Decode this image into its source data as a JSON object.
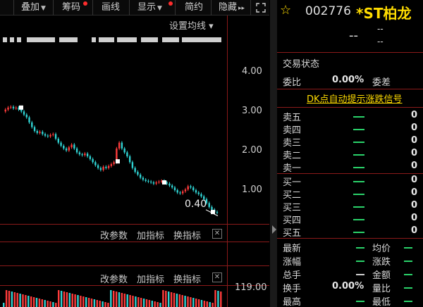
{
  "toolbar": {
    "items": [
      {
        "label": "叠加",
        "arrow": "▼",
        "dot": false
      },
      {
        "label": "筹码",
        "arrow": "",
        "dot": true
      },
      {
        "label": "画线",
        "arrow": "",
        "dot": false
      },
      {
        "label": "显示",
        "arrow": "▼",
        "dot": true
      },
      {
        "label": "简约",
        "arrow": "",
        "dot": false
      },
      {
        "label": "隐藏",
        "arrow": "▸▸",
        "dot": false
      }
    ],
    "expand_icon": "expand-icon"
  },
  "chart": {
    "ma_setting_label": "设置均线",
    "ma_setting_arrow": "▾",
    "y_ticks": [
      "4.00",
      "3.00",
      "2.00",
      "1.00"
    ],
    "last_price_label": "0.40",
    "price_panel_buttons": [
      "改参数",
      "加指标",
      "换指标"
    ],
    "volume_panel_buttons": [
      "改参数",
      "加指标",
      "换指标"
    ],
    "close_symbol": "✕",
    "volume_axis_top": "119.00",
    "up_color": "#ff3b3b",
    "down_color": "#2fd3d3",
    "price_series": [
      3.0,
      3.05,
      3.1,
      3.12,
      3.08,
      3.1,
      3.05,
      3.0,
      2.92,
      2.85,
      2.72,
      2.6,
      2.5,
      2.45,
      2.48,
      2.42,
      2.38,
      2.36,
      2.4,
      2.42,
      2.3,
      2.2,
      2.12,
      2.05,
      2.0,
      2.08,
      2.15,
      2.05,
      1.95,
      1.9,
      1.88,
      1.92,
      1.85,
      1.78,
      1.7,
      1.62,
      1.55,
      1.5,
      1.58,
      1.55,
      1.6,
      1.65,
      1.7,
      2.05,
      2.2,
      2.05,
      1.95,
      1.85,
      1.7,
      1.55,
      1.45,
      1.38,
      1.3,
      1.25,
      1.22,
      1.2,
      1.18,
      1.15,
      1.18,
      1.2,
      1.22,
      1.18,
      1.15,
      1.1,
      1.05,
      0.98,
      0.92,
      0.9,
      0.95,
      1.0,
      1.08,
      1.05,
      0.98,
      0.92,
      0.88,
      0.82,
      0.75,
      0.65,
      0.55,
      0.48,
      0.42,
      0.4
    ]
  },
  "quote": {
    "code": "002776",
    "name": "*ST柏龙",
    "price": "--",
    "change": "--",
    "change_pct": "--",
    "trade_status_label": "交易状态",
    "weibi_label": "委比",
    "weibi_value": "0.00%",
    "weicha_label": "委差",
    "dk_link": "DK点自动提示涨跌信号",
    "sell_labels": [
      "卖五",
      "卖四",
      "卖三",
      "卖二",
      "卖一"
    ],
    "buy_labels": [
      "买一",
      "买二",
      "买三",
      "买四",
      "买五"
    ],
    "order_qty": "0",
    "stats": [
      {
        "left": "最新",
        "right": "均价"
      },
      {
        "left": "涨幅",
        "right": "涨跌"
      },
      {
        "left": "总手",
        "right": "金额"
      },
      {
        "left": "换手",
        "mid": "0.00%",
        "right": "量比"
      },
      {
        "left": "最高",
        "right": "最低"
      }
    ],
    "dash_color": "#2ad26a"
  }
}
